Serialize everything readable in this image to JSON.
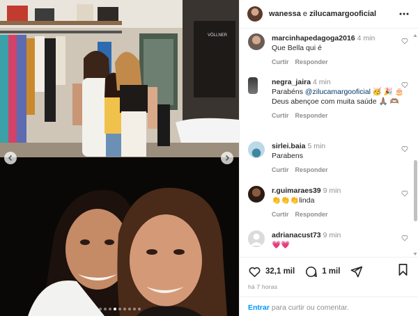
{
  "post": {
    "users": [
      "wanessa",
      "zilucamargooficial"
    ],
    "connector": " e ",
    "more_icon": "more-horizontal-icon",
    "carousel_dots": 9,
    "carousel_active_index": 3
  },
  "comments": [
    {
      "user": "marcinhapedagoga2016",
      "time": "4 min",
      "text": "Que Bella qui é",
      "reply_label": "Responder",
      "like_label": "Curtir",
      "avatar_color": "#7d6f66"
    },
    {
      "user": "negra_jaira",
      "time": "4 min",
      "text_prefix": "Parabéns ",
      "mention": "@zilucamargooficial",
      "text_suffix": " 🥳 🎉 🎂 Deus abençoe com muita saúde 🙏🏽 🫶🏽",
      "reply_label": "Responder",
      "like_label": "Curtir",
      "avatar_color": "#3a3a3a"
    },
    {
      "user": "sirlei.baia",
      "time": "5 min",
      "text": "Parabens",
      "reply_label": "Responder",
      "like_label": "Curtir",
      "avatar_color": "#9ec3d6"
    },
    {
      "user": "r.guimaraes39",
      "time": "9 min",
      "text": "👏👏👏linda",
      "reply_label": "Responder",
      "like_label": "Curtir",
      "avatar_color": "#3b2a22"
    },
    {
      "user": "adrianacust73",
      "time": "9 min",
      "text": "💗💗",
      "reply_label": "Responder",
      "like_label": "Curtir",
      "avatar_color": "#dbdbdb"
    }
  ],
  "actions": {
    "like_count": "32,1 mil",
    "comment_count": "1 mil",
    "time_ago": "há 7 horas"
  },
  "login": {
    "link": "Entrar",
    "text": " para curtir ou comentar."
  },
  "colors": {
    "link_blue": "#0095f6",
    "mention": "#00376b",
    "muted": "#8e8e8e",
    "border": "#efefef"
  }
}
